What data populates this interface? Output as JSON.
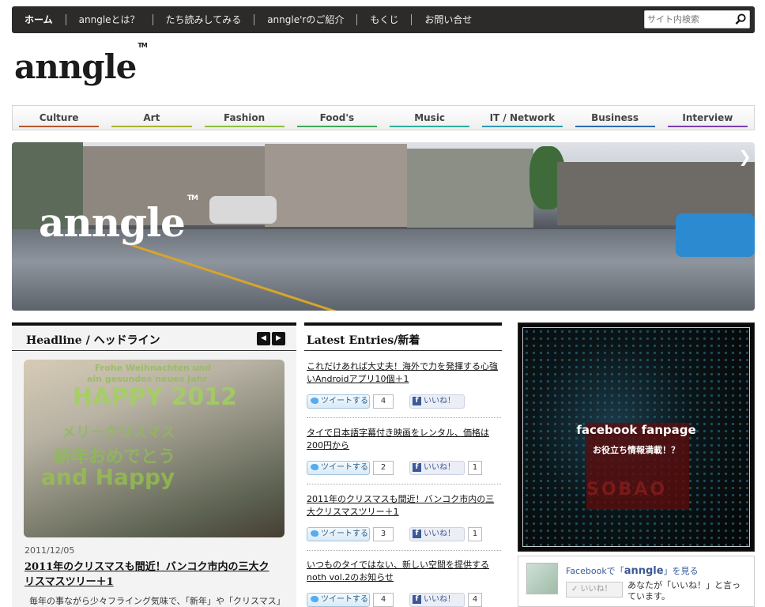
{
  "nav": {
    "items": [
      "ホーム",
      "anngleとは？",
      "たち読みしてみる",
      "anngle'rのご紹介",
      "もくじ",
      "お問い合せ"
    ],
    "search_placeholder": "サイト内検索"
  },
  "logo": {
    "text": "anngle",
    "tm": "TM"
  },
  "categories": [
    {
      "label": "Culture",
      "color": "#b5562f"
    },
    {
      "label": "Art",
      "color": "#a7b22f"
    },
    {
      "label": "Fashion",
      "color": "#8cbf3f"
    },
    {
      "label": "Food's",
      "color": "#3fa95a"
    },
    {
      "label": "Music",
      "color": "#2fae9b"
    },
    {
      "label": "IT / Network",
      "color": "#2f9ab3"
    },
    {
      "label": "Business",
      "color": "#2f68b0"
    },
    {
      "label": "Interview",
      "color": "#7a3fb0"
    }
  ],
  "hero": {
    "logo": "anngle",
    "tm": "TM",
    "next": "❯"
  },
  "headline": {
    "heading": "Headline / ヘッドライン",
    "prev": "◀",
    "next": "▶",
    "image_texts": [
      "Frohe Weihnachten und",
      "ein gesundes neues Jahr",
      "HAPPY 2012",
      "メリークリスマス",
      "新年おめでとう",
      "and Happy"
    ],
    "date": "2011/12/05",
    "title": "2011年のクリスマスも間近！バンコク市内の三大クリスマスツリー＋1",
    "excerpt": "毎年の事ながら少々フライング気味で、「新年」や「クリスマス」"
  },
  "latest": {
    "heading": "Latest Entries/新着",
    "tweet_label": "ツイートする",
    "like_label": "いいね！",
    "entries": [
      {
        "title": "これだけあれば大丈夫！海外で力を発揮する心強いAndroidアプリ10個＋1",
        "tweets": "4",
        "likes": ""
      },
      {
        "title": "タイで日本語字幕付き映画をレンタル、価格は200円から",
        "tweets": "2",
        "likes": "1"
      },
      {
        "title": "2011年のクリスマスも間近！バンコク市内の三大クリスマスツリー＋1",
        "tweets": "3",
        "likes": "1"
      },
      {
        "title": "いつものタイではない、新しい空間を提供するnoth vol.2のお知らせ",
        "tweets": "4",
        "likes": "4"
      }
    ]
  },
  "fb_banner": {
    "title": "facebook fanpage",
    "subtitle": "お役立ち情報満載！？",
    "watermark": "SOBAO"
  },
  "fb_box": {
    "prefix": "Facebookで「",
    "name": "anngle",
    "suffix": "」を見る",
    "like_button": "✓ いいね！",
    "text": "あなたが「いいね！」と言っています。"
  }
}
